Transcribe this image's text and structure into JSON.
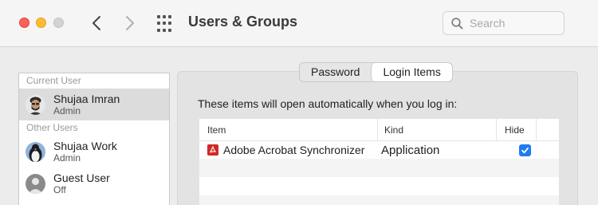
{
  "window": {
    "title": "Users & Groups",
    "search": {
      "placeholder": "Search",
      "value": ""
    }
  },
  "sidebar": {
    "current_user_header": "Current User",
    "current_user": {
      "name": "Shujaa Imran",
      "role": "Admin",
      "avatar_icon": "memoji-avatar-icon"
    },
    "other_users_header": "Other Users",
    "other_users": [
      {
        "name": "Shujaa Work",
        "role": "Admin",
        "avatar_icon": "penguin-avatar-icon"
      },
      {
        "name": "Guest User",
        "role": "Off",
        "avatar_icon": "generic-user-avatar-icon"
      }
    ]
  },
  "main": {
    "tabs": [
      {
        "label": "Password",
        "selected": false
      },
      {
        "label": "Login Items",
        "selected": true
      }
    ],
    "description": "These items will open automatically when you log in:",
    "table": {
      "columns": [
        "Item",
        "Kind",
        "Hide"
      ],
      "rows": [
        {
          "item": "Adobe Acrobat Synchronizer",
          "kind": "Application",
          "hide": true,
          "icon": "adobe-acrobat-icon"
        }
      ]
    }
  },
  "colors": {
    "accent": "#1f7bf0",
    "close": "#fe5f57",
    "minimize": "#febc2e",
    "zoom_disabled": "#d4d3d4",
    "acrobat_red": "#cf2a24"
  }
}
